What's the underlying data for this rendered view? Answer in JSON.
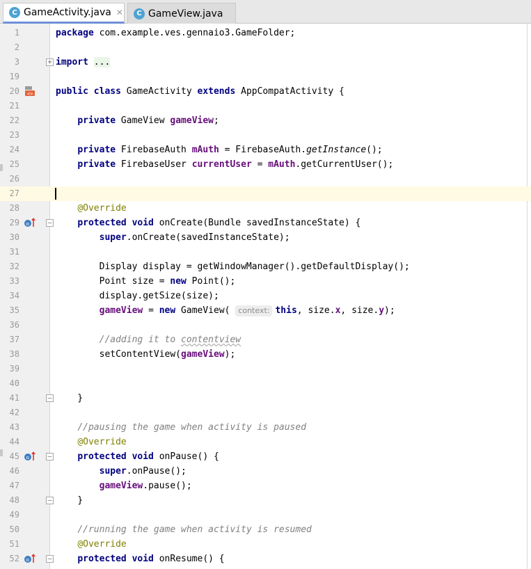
{
  "tabs": [
    {
      "label": "GameActivity.java",
      "icon": "C",
      "active": true
    },
    {
      "label": "GameView.java",
      "icon": "C",
      "active": false
    }
  ],
  "colors": {
    "keyword": "#000080",
    "field": "#660e7a",
    "annotation": "#808000",
    "comment": "#808080",
    "current_line": "#fffae3",
    "tab_underline": "#6f8fd8"
  },
  "lines": [
    {
      "n": "1",
      "html": "<span class='kw'>package</span> com.example.ves.gennaio3.GameFolder;"
    },
    {
      "n": "2",
      "html": ""
    },
    {
      "n": "3",
      "html": "<span class='kw'>import</span> <span class='dots'>...</span>"
    },
    {
      "n": "19",
      "html": ""
    },
    {
      "n": "20",
      "html": "<span class='kw'>public class</span> GameActivity <span class='kw'>extends</span> AppCompatActivity {"
    },
    {
      "n": "21",
      "html": ""
    },
    {
      "n": "22",
      "html": "    <span class='kw'>private</span> GameView <span class='fld'>gameView</span>;"
    },
    {
      "n": "23",
      "html": ""
    },
    {
      "n": "24",
      "html": "    <span class='kw'>private</span> FirebaseAuth <span class='fld'>mAuth</span> = FirebaseAuth.<span class='it'>getInstance</span>();"
    },
    {
      "n": "25",
      "html": "    <span class='kw'>private</span> FirebaseUser <span class='fld'>currentUser</span> = <span class='fld'>mAuth</span>.getCurrentUser();"
    },
    {
      "n": "26",
      "html": ""
    },
    {
      "n": "27",
      "html": ""
    },
    {
      "n": "28",
      "html": "    <span class='ann'>@Override</span>"
    },
    {
      "n": "29",
      "html": "    <span class='kw'>protected void</span> onCreate(Bundle savedInstanceState) {"
    },
    {
      "n": "30",
      "html": "        <span class='kw'>super</span>.onCreate(savedInstanceState);"
    },
    {
      "n": "31",
      "html": ""
    },
    {
      "n": "32",
      "html": "        Display display = getWindowManager().getDefaultDisplay();"
    },
    {
      "n": "33",
      "html": "        Point size = <span class='kw'>new</span> Point();"
    },
    {
      "n": "34",
      "html": "        display.getSize(size);"
    },
    {
      "n": "35",
      "html": "        <span class='fld'>gameView</span> = <span class='kw'>new</span> GameView( <span class='hint'>context:</span><span class='kw'>this</span>, size.<span class='fld'>x</span>, size.<span class='fld'>y</span>);"
    },
    {
      "n": "36",
      "html": ""
    },
    {
      "n": "37",
      "html": "        <span class='cm'>//adding it to <span class='squig'>contentview</span></span>"
    },
    {
      "n": "38",
      "html": "        setContentView(<span class='fld'>gameView</span>);"
    },
    {
      "n": "39",
      "html": ""
    },
    {
      "n": "40",
      "html": ""
    },
    {
      "n": "41",
      "html": "    }"
    },
    {
      "n": "42",
      "html": ""
    },
    {
      "n": "43",
      "html": "    <span class='cm'>//pausing the game when activity is paused</span>"
    },
    {
      "n": "44",
      "html": "    <span class='ann'>@Override</span>"
    },
    {
      "n": "45",
      "html": "    <span class='kw'>protected void</span> onPause() {"
    },
    {
      "n": "46",
      "html": "        <span class='kw'>super</span>.onPause();"
    },
    {
      "n": "47",
      "html": "        <span class='fld'>gameView</span>.pause();"
    },
    {
      "n": "48",
      "html": "    }"
    },
    {
      "n": "49",
      "html": ""
    },
    {
      "n": "50",
      "html": "    <span class='cm'>//running the game when activity is resumed</span>"
    },
    {
      "n": "51",
      "html": "    <span class='ann'>@Override</span>"
    },
    {
      "n": "52",
      "html": "    <span class='kw'>protected void</span> onResume() {"
    }
  ],
  "current_line": "27",
  "fold_lines": {
    "plus": [
      "3"
    ],
    "minus": [
      "29",
      "41",
      "45",
      "48",
      "52"
    ]
  },
  "gutter_icons": {
    "class-icon": [
      "20"
    ],
    "override-icon": [
      "29",
      "45",
      "52"
    ]
  }
}
